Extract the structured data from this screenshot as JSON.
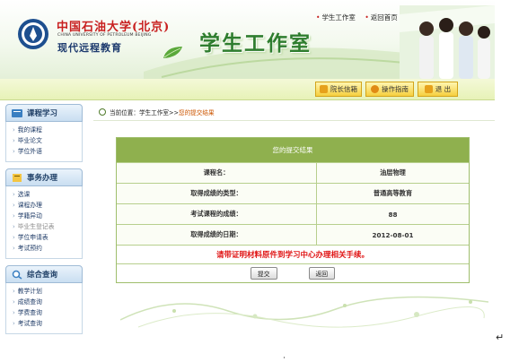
{
  "header": {
    "logo_cn": "中国石油大学(北京)",
    "logo_en": "CHINA UNIVERSITY OF PETROLEUM BEIJING",
    "logo_sub": "现代远程教育",
    "site_title": "学生工作室",
    "top_links": [
      "学生工作室",
      "返回首页"
    ]
  },
  "toolbar": {
    "buttons": [
      {
        "label": "院长信箱",
        "icon": "mailbox-icon"
      },
      {
        "label": "操作指南",
        "icon": "clock-icon"
      },
      {
        "label": "退 出",
        "icon": "exit-icon"
      }
    ]
  },
  "sidebar": {
    "sections": [
      {
        "title": "课程学习",
        "items": [
          "我的课程",
          "毕业论文",
          "学位外语"
        ]
      },
      {
        "title": "事务办理",
        "items": [
          "选课",
          "课程办理",
          "学籍异动",
          "毕业生登记表",
          "学位申请表",
          "考试预约"
        ]
      },
      {
        "title": "综合查询",
        "items": [
          "教学计划",
          "成绩查询",
          "学费查询",
          "考试查询"
        ]
      }
    ]
  },
  "breadcrumb": {
    "prefix": "当前位置：学生工作室",
    "sep": ">>",
    "current": "您的提交结果"
  },
  "result": {
    "title": "您的提交结果",
    "rows": [
      {
        "label": "课程名：",
        "value": "油层物理"
      },
      {
        "label": "取得成绩的类型：",
        "value": "普通高等教育"
      },
      {
        "label": "考试课程的成绩：",
        "value": "88"
      },
      {
        "label": "取得成绩的日期：",
        "value": "2012-08-01"
      }
    ],
    "notice": "请带证明材料原件到学习中心办理相关手续。",
    "submit_label": "提交",
    "back_label": "返回"
  },
  "colors": {
    "header_green": "#8fb04e",
    "title_green": "#2e7d2e",
    "notice_red": "#e01414",
    "link_orange": "#cc5500"
  }
}
